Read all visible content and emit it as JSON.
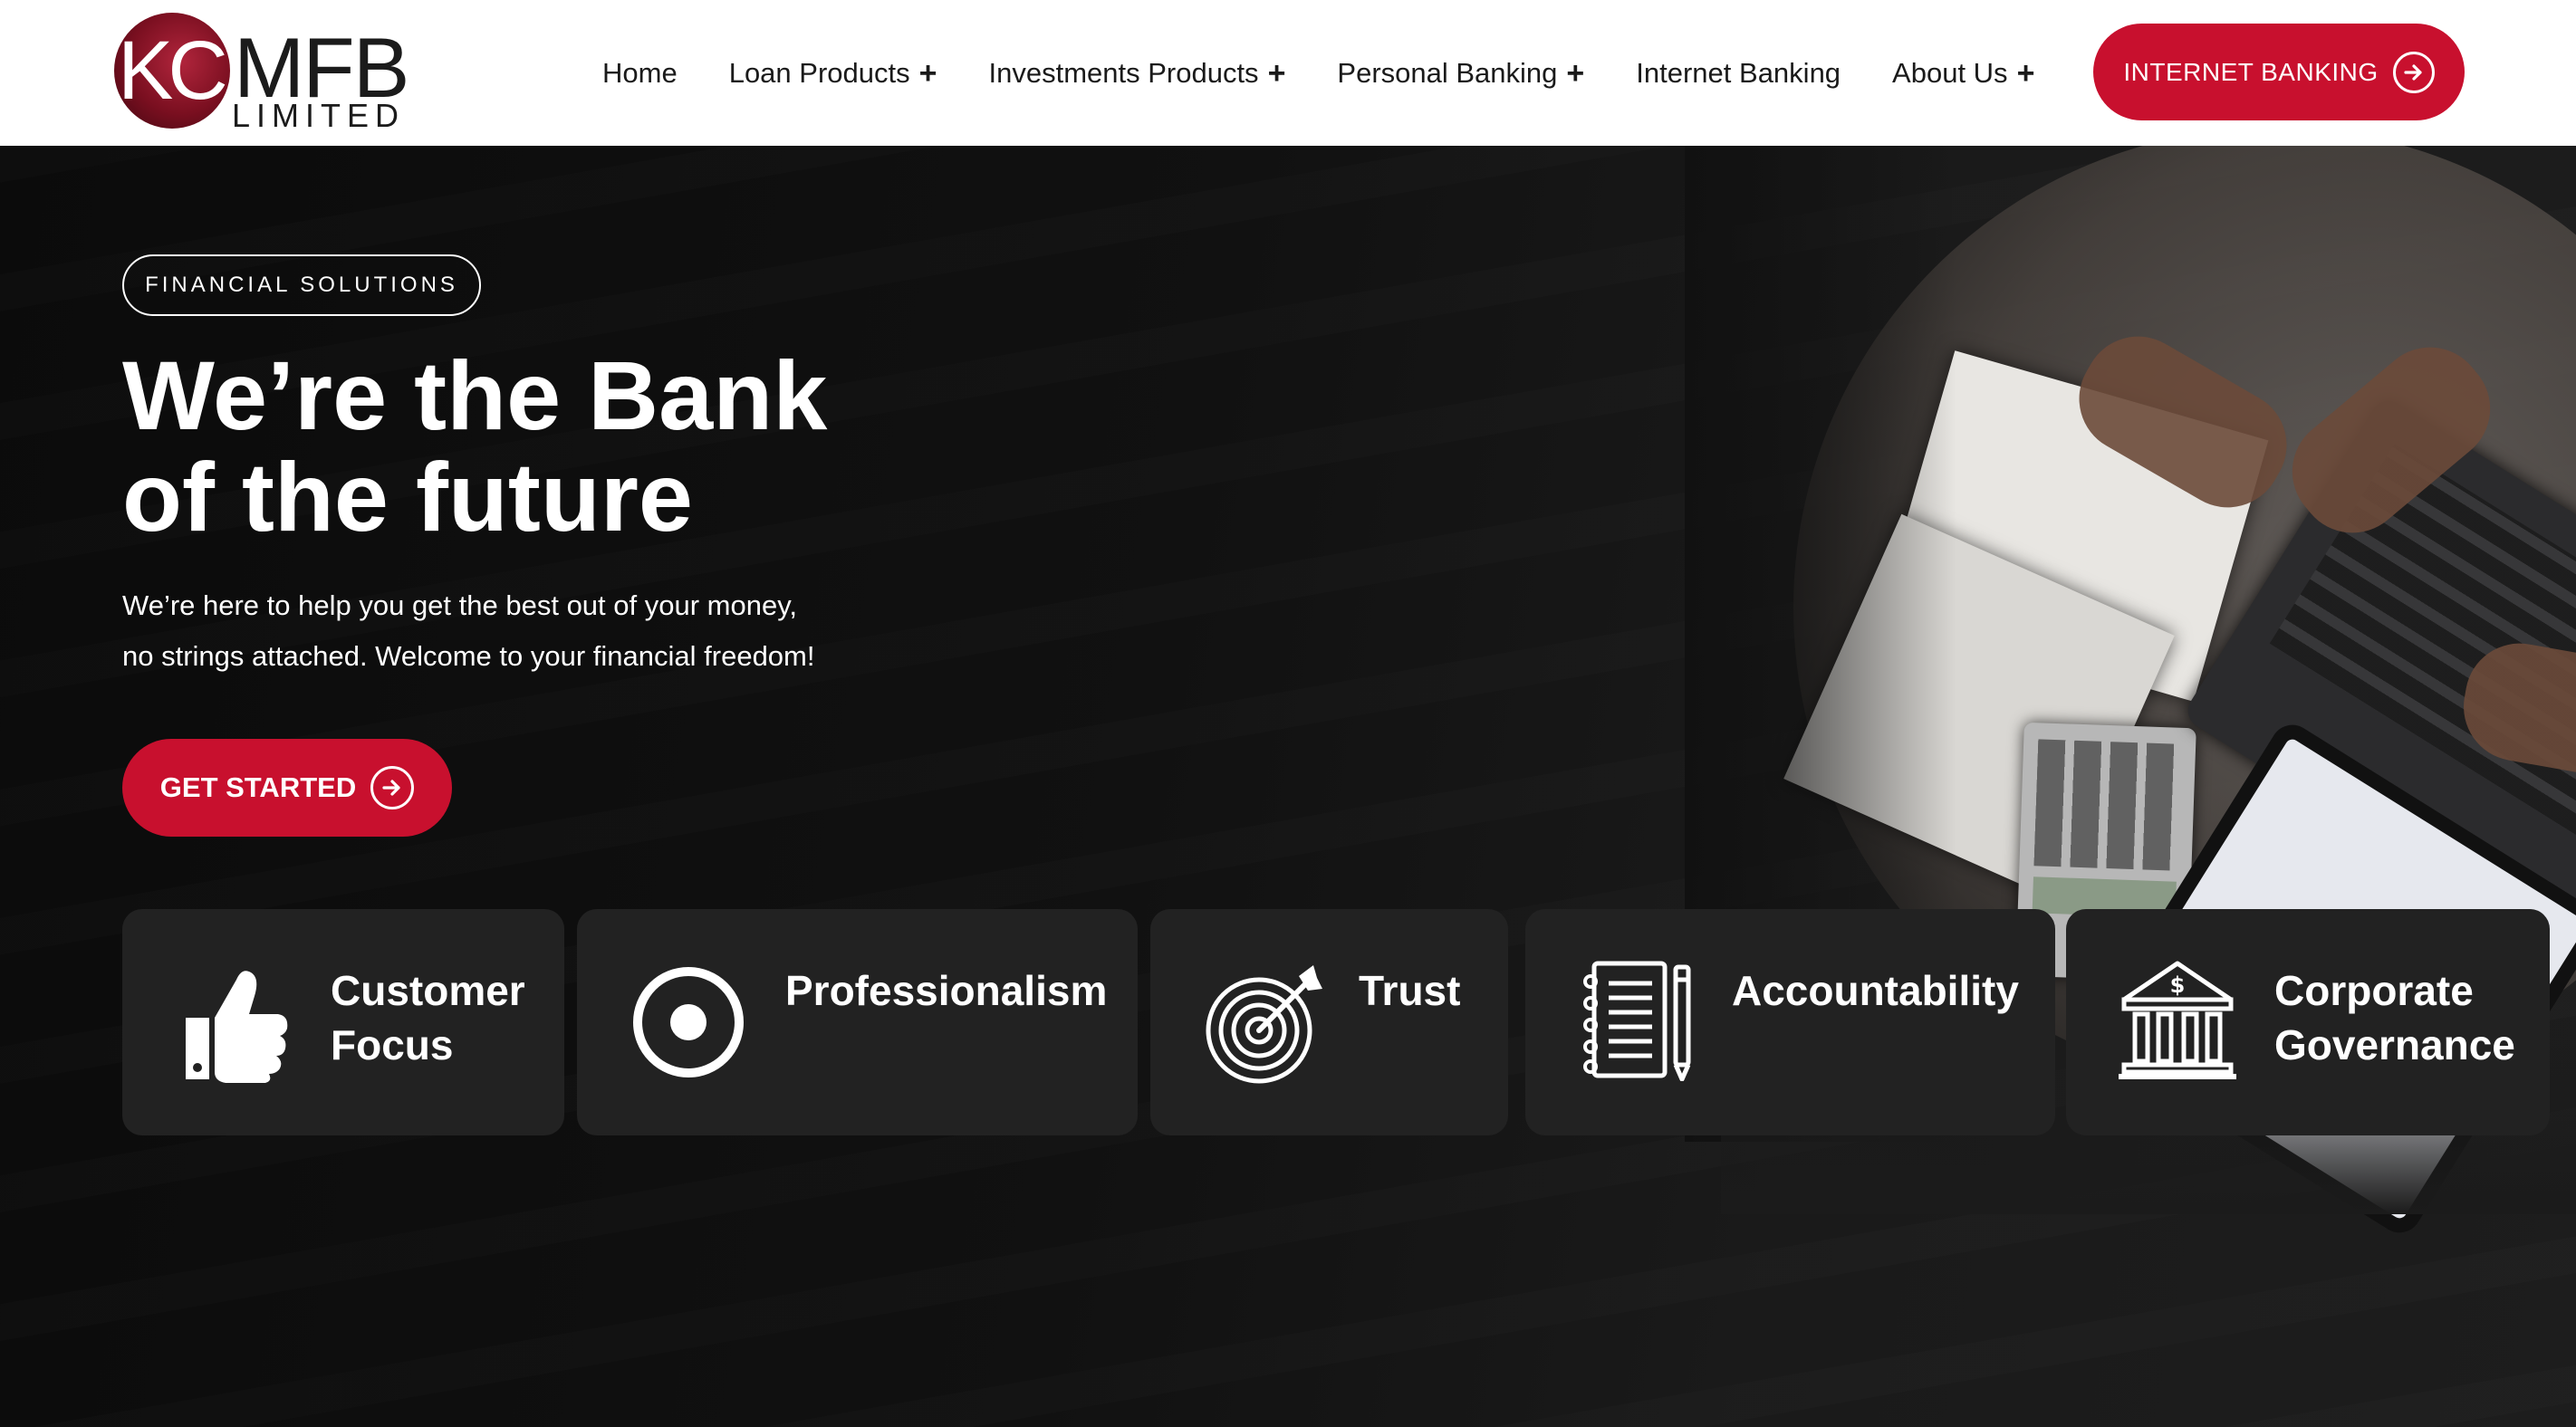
{
  "header": {
    "logo": {
      "kc": "KC",
      "mfb": "MFB",
      "limited": "LIMITED"
    },
    "nav": [
      {
        "label": "Home",
        "has_submenu": false
      },
      {
        "label": "Loan Products",
        "has_submenu": true
      },
      {
        "label": "Investments Products",
        "has_submenu": true
      },
      {
        "label": "Personal Banking",
        "has_submenu": true
      },
      {
        "label": "Internet Banking",
        "has_submenu": false
      },
      {
        "label": "About Us",
        "has_submenu": true
      }
    ],
    "submenu_glyph": "+",
    "cta_label": "INTERNET BANKING",
    "cta_icon": "arrow-right-circle-icon"
  },
  "hero": {
    "tag": "FINANCIAL SOLUTIONS",
    "title_line1": "We’re the Bank",
    "title_line2": "of the future",
    "subtitle_line1": "We’re here to help you get the best out of your money,",
    "subtitle_line2": "no strings attached. Welcome to your financial freedom!",
    "cta_label": "GET STARTED",
    "cta_icon": "arrow-right-circle-icon"
  },
  "values": [
    {
      "line1": "Customer",
      "line2": "Focus",
      "icon": "thumbs-up-icon"
    },
    {
      "line1": "Professionalism",
      "line2": "",
      "icon": "target-circle-icon"
    },
    {
      "line1": "Trust",
      "line2": "",
      "icon": "bullseye-arrow-icon"
    },
    {
      "line1": "Accountability",
      "line2": "",
      "icon": "notebook-pencil-icon"
    },
    {
      "line1": "Corporate",
      "line2": "Governance",
      "icon": "bank-building-icon"
    }
  ],
  "colors": {
    "brand_red": "#c8102e",
    "header_bg": "#ffffff",
    "hero_bg": "#111111",
    "card_bg": "#222222",
    "text_light": "#ffffff",
    "text_dark": "#1a1a1a"
  }
}
